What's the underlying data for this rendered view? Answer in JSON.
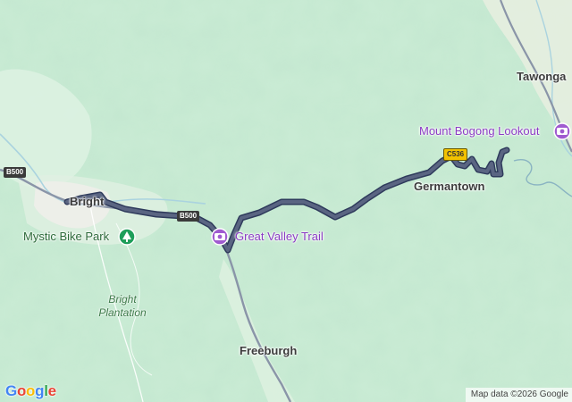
{
  "map": {
    "places": {
      "bright": "Bright",
      "tawonga": "Tawonga",
      "germantown": "Germantown",
      "freeburgh": "Freeburgh",
      "bright_plantation_line1": "Bright",
      "bright_plantation_line2": "Plantation"
    },
    "points_of_interest": {
      "mystic_bike_park": "Mystic Bike Park",
      "great_valley_trail": "Great Valley Trail",
      "mount_bogong_lookout": "Mount Bogong Lookout"
    },
    "road_shields": {
      "b500_west": "B500",
      "b500_route": "B500",
      "c536": "C536"
    },
    "attribution": "Map data ©2026 Google",
    "logo_text": "Google",
    "colors": {
      "terrain": "#c9ebd4",
      "route": "#5a6582",
      "route_casing": "#2f3b5c",
      "highway": "#8a95a8",
      "poi_purple": "#a05bd0",
      "park_green": "#1e9e5a"
    }
  }
}
